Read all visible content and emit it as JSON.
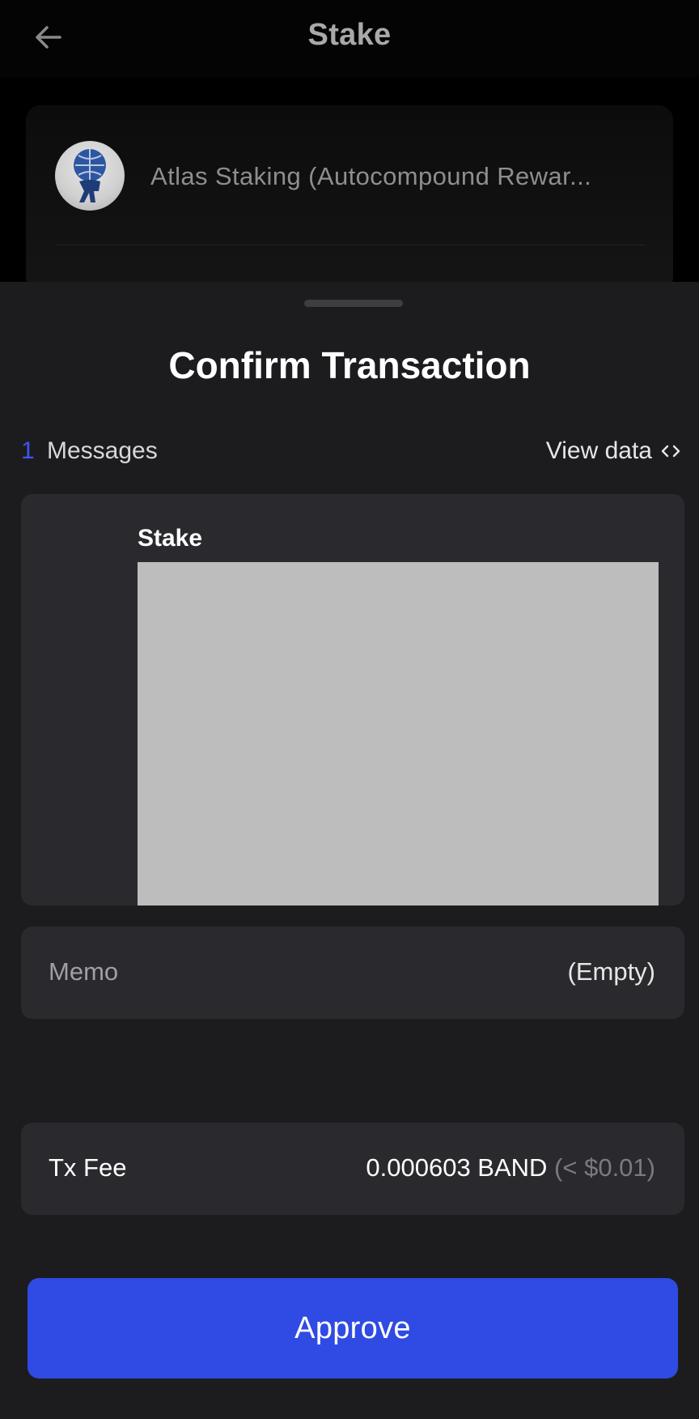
{
  "header": {
    "title": "Stake",
    "back_icon": "arrow-left-icon"
  },
  "validator": {
    "name": "Atlas Staking (Autocompound Rewar...",
    "avatar_icon": "atlas-logo-icon"
  },
  "sheet": {
    "title": "Confirm Transaction",
    "messages": {
      "count": "1",
      "label": "Messages",
      "view_data_label": "View data",
      "view_data_icon": "code-brackets-icon"
    },
    "message_card": {
      "title": "Stake"
    },
    "memo": {
      "label": "Memo",
      "value": "(Empty)"
    },
    "fee": {
      "label": "Tx Fee",
      "amount": "0.000603 BAND",
      "usd": " (< $0.01)"
    },
    "approve_label": "Approve"
  },
  "colors": {
    "accent": "#2f4be3",
    "count_blue": "#3e56f0",
    "sheet_bg": "#1c1c1f",
    "card_bg": "#2a2a2e"
  }
}
